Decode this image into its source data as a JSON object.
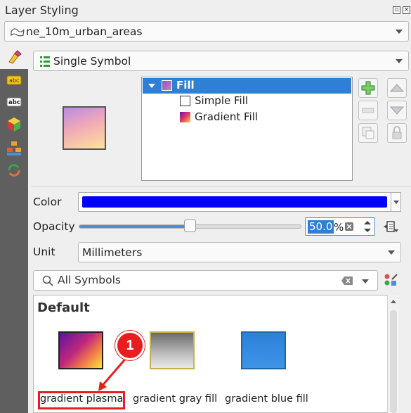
{
  "panel": {
    "title": "Layer Styling"
  },
  "layer_combo": {
    "value": "ne_10m_urban_areas",
    "icon": "polygon-layer-icon"
  },
  "renderer_combo": {
    "value": "Single Symbol",
    "icon": "single-symbol-icon"
  },
  "sidebar": {
    "items": [
      {
        "icon": "symbology-icon",
        "active": true
      },
      {
        "icon": "labels-icon"
      },
      {
        "icon": "masks-icon"
      },
      {
        "icon": "3d-view-icon"
      },
      {
        "icon": "diagrams-icon"
      },
      {
        "icon": "history-icon"
      }
    ]
  },
  "symbol_tree": {
    "items": [
      {
        "label": "Fill",
        "level": 0,
        "selected": true
      },
      {
        "label": "Simple Fill",
        "level": 1
      },
      {
        "label": "Gradient Fill",
        "level": 1
      }
    ]
  },
  "properties": {
    "color_label": "Color",
    "color_value": "#0000ff",
    "opacity_label": "Opacity",
    "opacity_value": "50.0",
    "opacity_unit": "%",
    "opacity_fraction": 0.5,
    "unit_label": "Unit",
    "unit_value": "Millimeters"
  },
  "symbols": {
    "search_placeholder": "All Symbols",
    "group_title": "Default",
    "items": [
      {
        "label": "gradient   plasma",
        "colors": [
          "#5b12a1",
          "#e0527a",
          "#f9e43a"
        ]
      },
      {
        "label": "gradient  gray fill",
        "colors": [
          "#6a6a6a",
          "#eaeaea"
        ]
      },
      {
        "label": "gradient blue fill",
        "colors": [
          "#2b80d9",
          "#3e95e6"
        ]
      }
    ]
  },
  "annotation": {
    "number": "1"
  }
}
